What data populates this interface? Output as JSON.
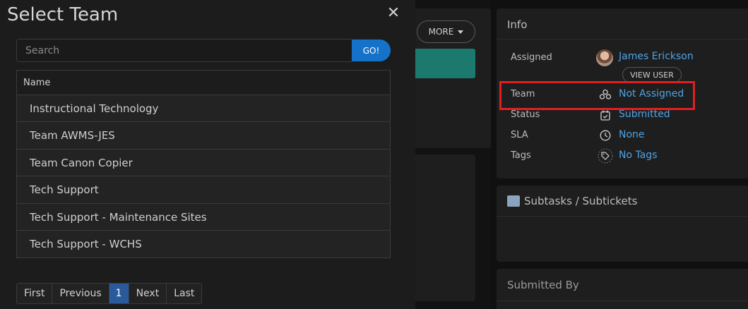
{
  "modal": {
    "title": "Select Team",
    "close_glyph": "✕",
    "search_placeholder": "Search",
    "go_label": "GO!",
    "table_header": "Name",
    "rows": [
      "Instructional Technology",
      "Team AWMS-JES",
      "Team Canon Copier",
      "Tech Support",
      "Tech Support - Maintenance Sites",
      "Tech Support - WCHS"
    ],
    "pagination": {
      "first": "First",
      "previous": "Previous",
      "current": "1",
      "next": "Next",
      "last": "Last"
    }
  },
  "background": {
    "more_label": "MORE"
  },
  "info": {
    "title": "Info",
    "assigned_label": "Assigned",
    "assigned_value": "James Erickson",
    "view_user_label": "VIEW USER",
    "team_label": "Team",
    "team_value": "Not Assigned",
    "status_label": "Status",
    "status_value": "Submitted",
    "sla_label": "SLA",
    "sla_value": "None",
    "tags_label": "Tags",
    "tags_value": "No Tags"
  },
  "subtasks": {
    "title": "Subtasks / Subtickets"
  },
  "submitted_by": {
    "title": "Submitted By"
  },
  "colors": {
    "accent": "#1473c9",
    "link": "#4ea3e6",
    "highlight": "#e02020",
    "teal": "#1b7a6d"
  }
}
